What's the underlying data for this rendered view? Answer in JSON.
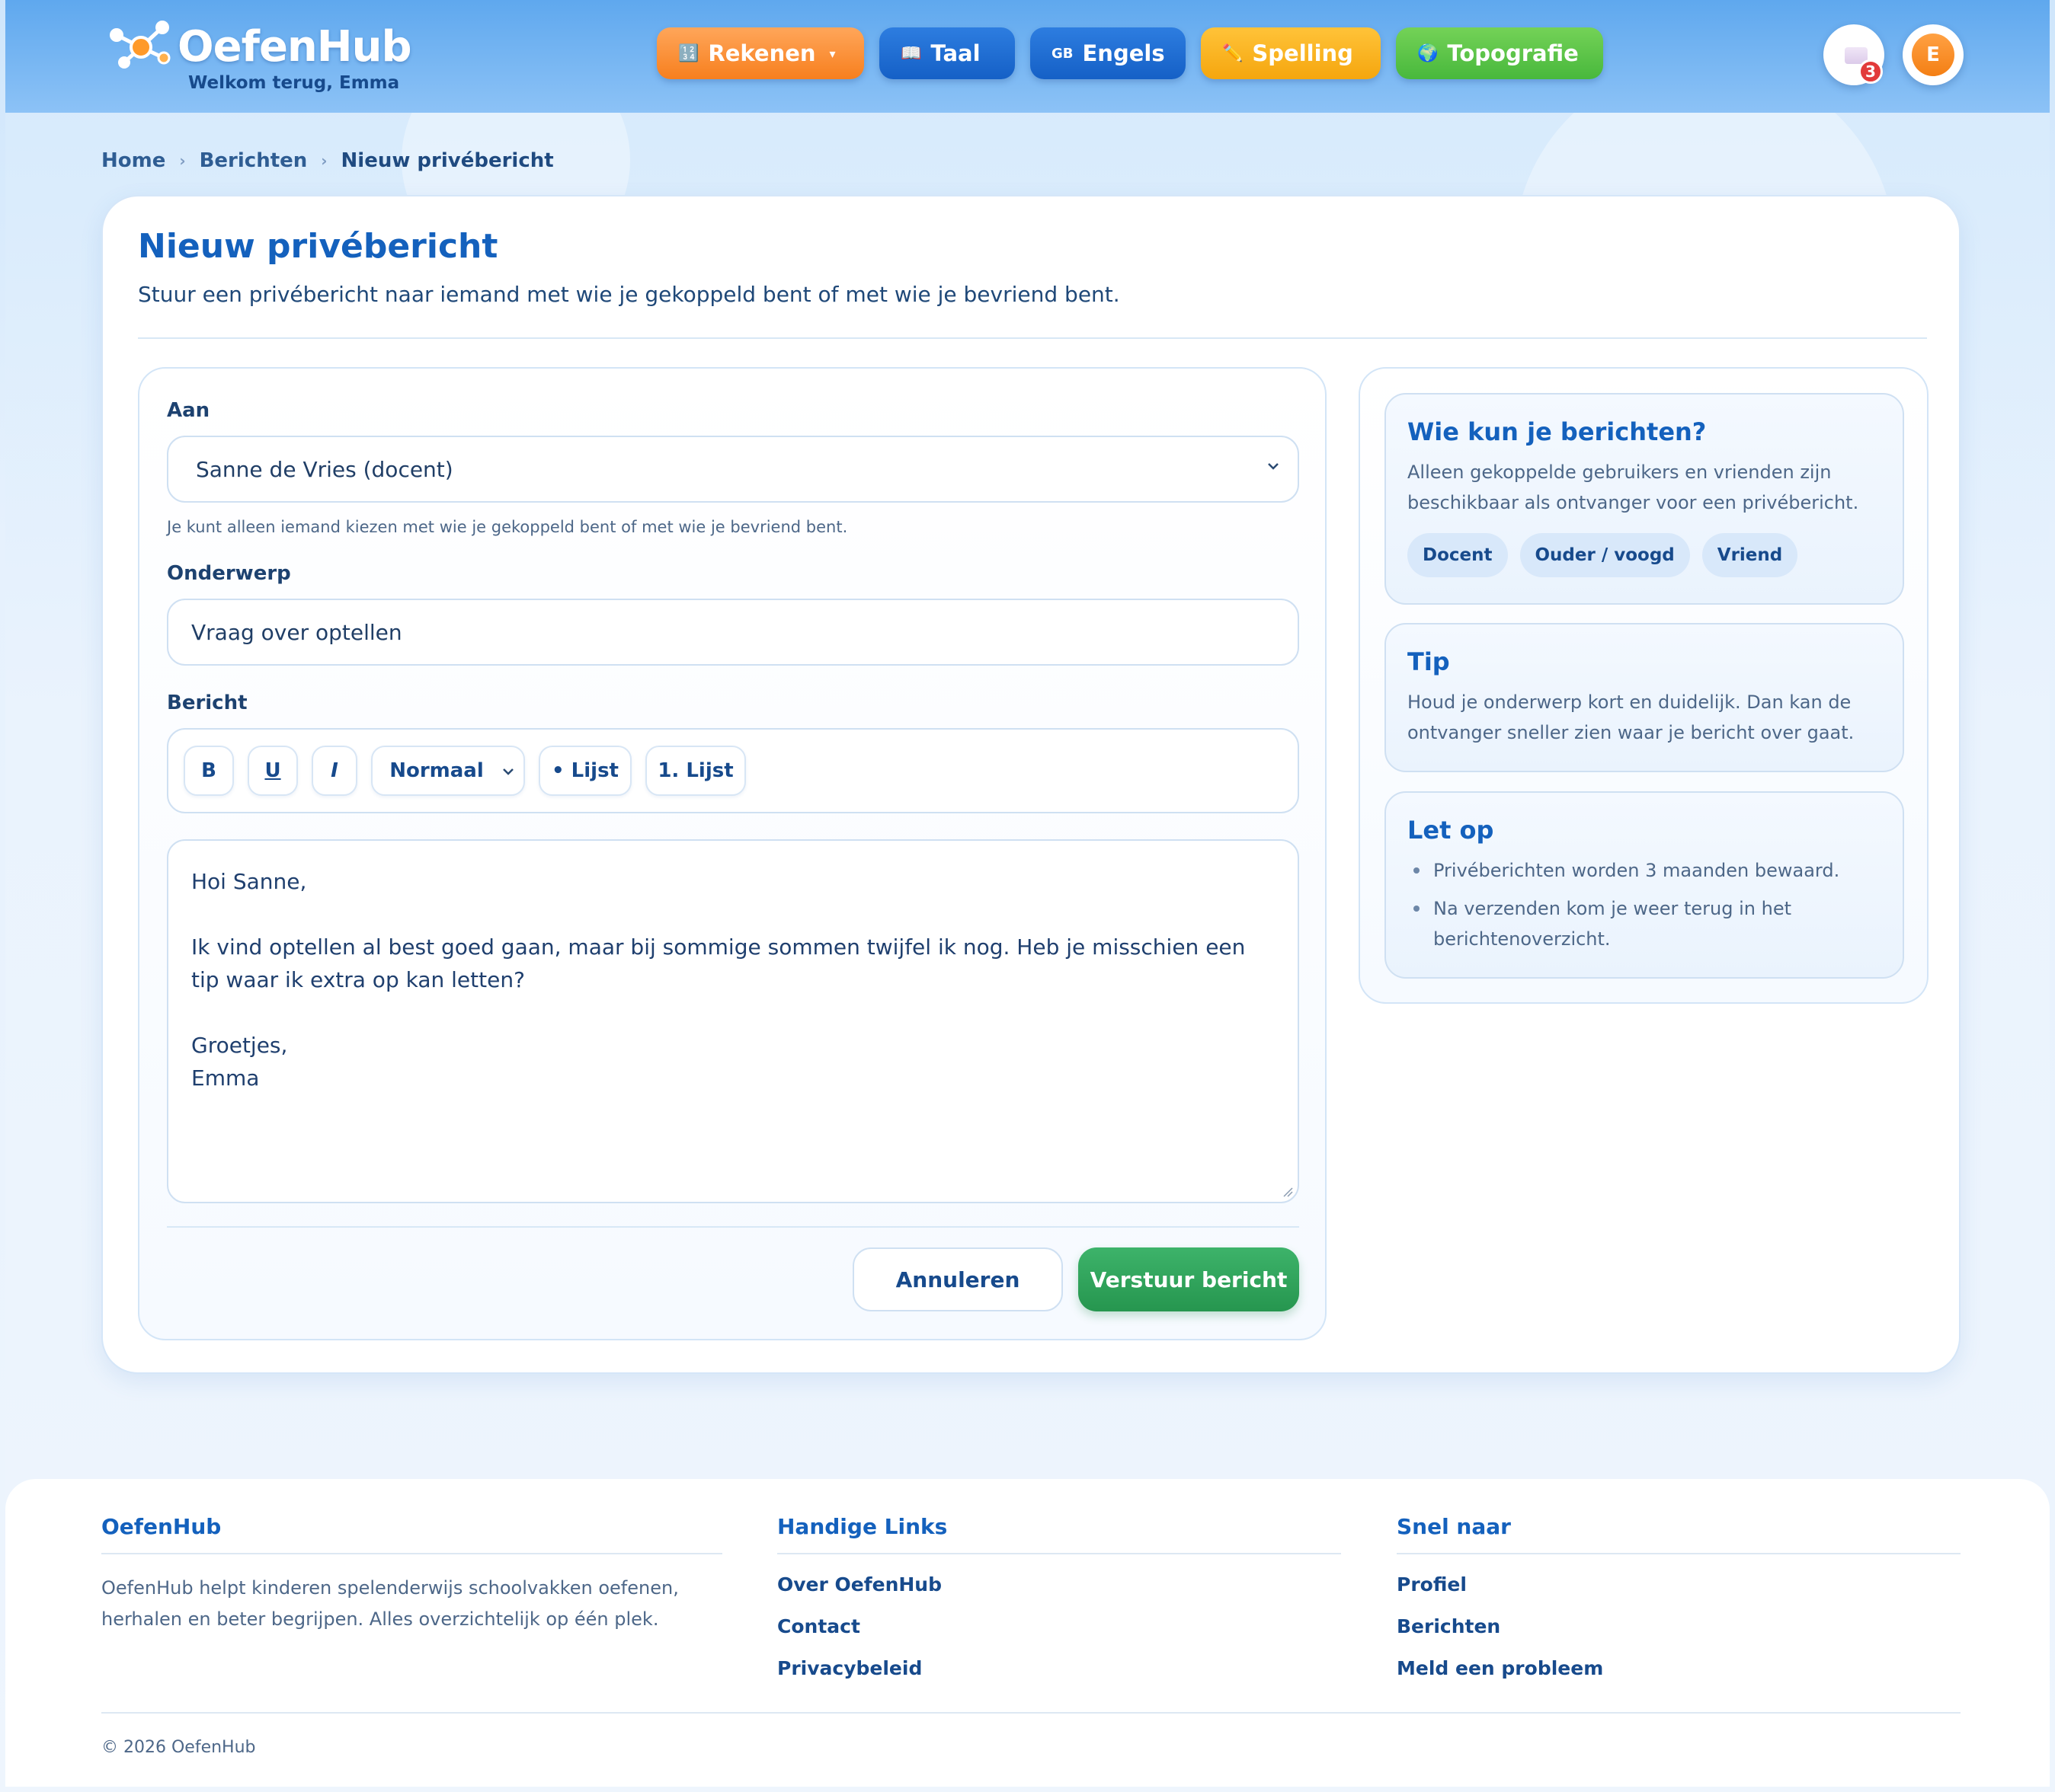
{
  "header": {
    "logo_text": "OefenHub",
    "welcome": "Welkom terug, Emma",
    "nav": [
      {
        "icon": "🔢",
        "label": "Rekenen",
        "has_dropdown": true,
        "color": "#f98a2a"
      },
      {
        "icon": "📖",
        "label": "Taal",
        "color": "#1a67cf"
      },
      {
        "icon": "GB",
        "label": "Engels",
        "color": "#1a67cf"
      },
      {
        "icon": "✏️",
        "label": "Spelling",
        "color": "#f7ad1a"
      },
      {
        "icon": "🌍",
        "label": "Topografie",
        "color": "#55c043"
      }
    ],
    "mail_badge_count": "3",
    "avatar_initial": "E"
  },
  "breadcrumb": [
    "Home",
    "Berichten",
    "Nieuw privébericht"
  ],
  "page": {
    "title": "Nieuw privébericht",
    "subtitle": "Stuur een privébericht naar iemand met wie je gekoppeld bent of met wie je bevriend bent."
  },
  "form": {
    "to_label": "Aan",
    "to_value": "Sanne de Vries (docent)",
    "to_helper": "Je kunt alleen iemand kiezen met wie je gekoppeld bent of met wie je bevriend bent.",
    "subject_label": "Onderwerp",
    "subject_value": "Vraag over optellen",
    "message_label": "Bericht",
    "toolbar": {
      "bold": "B",
      "underline": "U",
      "italic": "I",
      "format": "Normaal",
      "bullet_list": "• Lijst",
      "numbered_list": "1. Lijst"
    },
    "message_lines": [
      "Hoi Sanne,",
      "",
      "Ik vind optellen al best goed gaan, maar bij sommige sommen twijfel ik nog. Heb je misschien een tip waar ik extra op kan letten?",
      "",
      "Groetjes,",
      "Emma"
    ],
    "cancel_label": "Annuleren",
    "send_label": "Verstuur bericht",
    "send_color": "#2ea35b"
  },
  "sidebar": {
    "who": {
      "title": "Wie kun je berichten?",
      "text": "Alleen gekoppelde gebruikers en vrienden zijn beschikbaar als ontvanger voor een privébericht.",
      "chips": [
        "Docent",
        "Ouder / voogd",
        "Vriend"
      ]
    },
    "tip": {
      "title": "Tip",
      "text": "Houd je onderwerp kort en duidelijk. Dan kan de ontvanger sneller zien waar je bericht over gaat."
    },
    "note": {
      "title": "Let op",
      "items": [
        "Privéberichten worden 3 maanden bewaard.",
        "Na verzenden kom je weer terug in het berichtenoverzicht."
      ]
    }
  },
  "footer": {
    "col1": {
      "title": "OefenHub",
      "text": "OefenHub helpt kinderen spelenderwijs schoolvakken oefenen, herhalen en beter begrijpen. Alles overzichtelijk op één plek."
    },
    "col2": {
      "title": "Handige Links",
      "links": [
        "Over OefenHub",
        "Contact",
        "Privacybeleid"
      ]
    },
    "col3": {
      "title": "Snel naar",
      "links": [
        "Profiel",
        "Berichten",
        "Meld een probleem"
      ]
    },
    "copyright": "© 2026 OefenHub"
  }
}
